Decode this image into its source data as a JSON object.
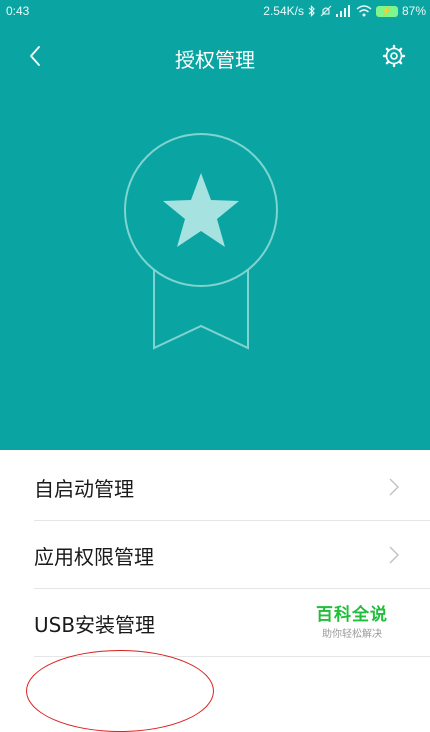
{
  "status_bar": {
    "time": "0:43",
    "net_speed": "2.54K/s",
    "battery_percent": "87%"
  },
  "header": {
    "title": "授权管理",
    "color": "#0aa5a2"
  },
  "icons": {
    "back": "chevron-left-icon",
    "settings": "gear-icon",
    "badge": "star-ribbon-badge-icon"
  },
  "menu": {
    "items": [
      {
        "label": "自启动管理",
        "chevron": true
      },
      {
        "label": "应用权限管理",
        "chevron": true
      },
      {
        "label": "USB安装管理",
        "chevron": false
      }
    ]
  },
  "watermark": {
    "title": "百科全说",
    "subtitle": "助你轻松解决"
  },
  "annotation_color": "#d9231f"
}
